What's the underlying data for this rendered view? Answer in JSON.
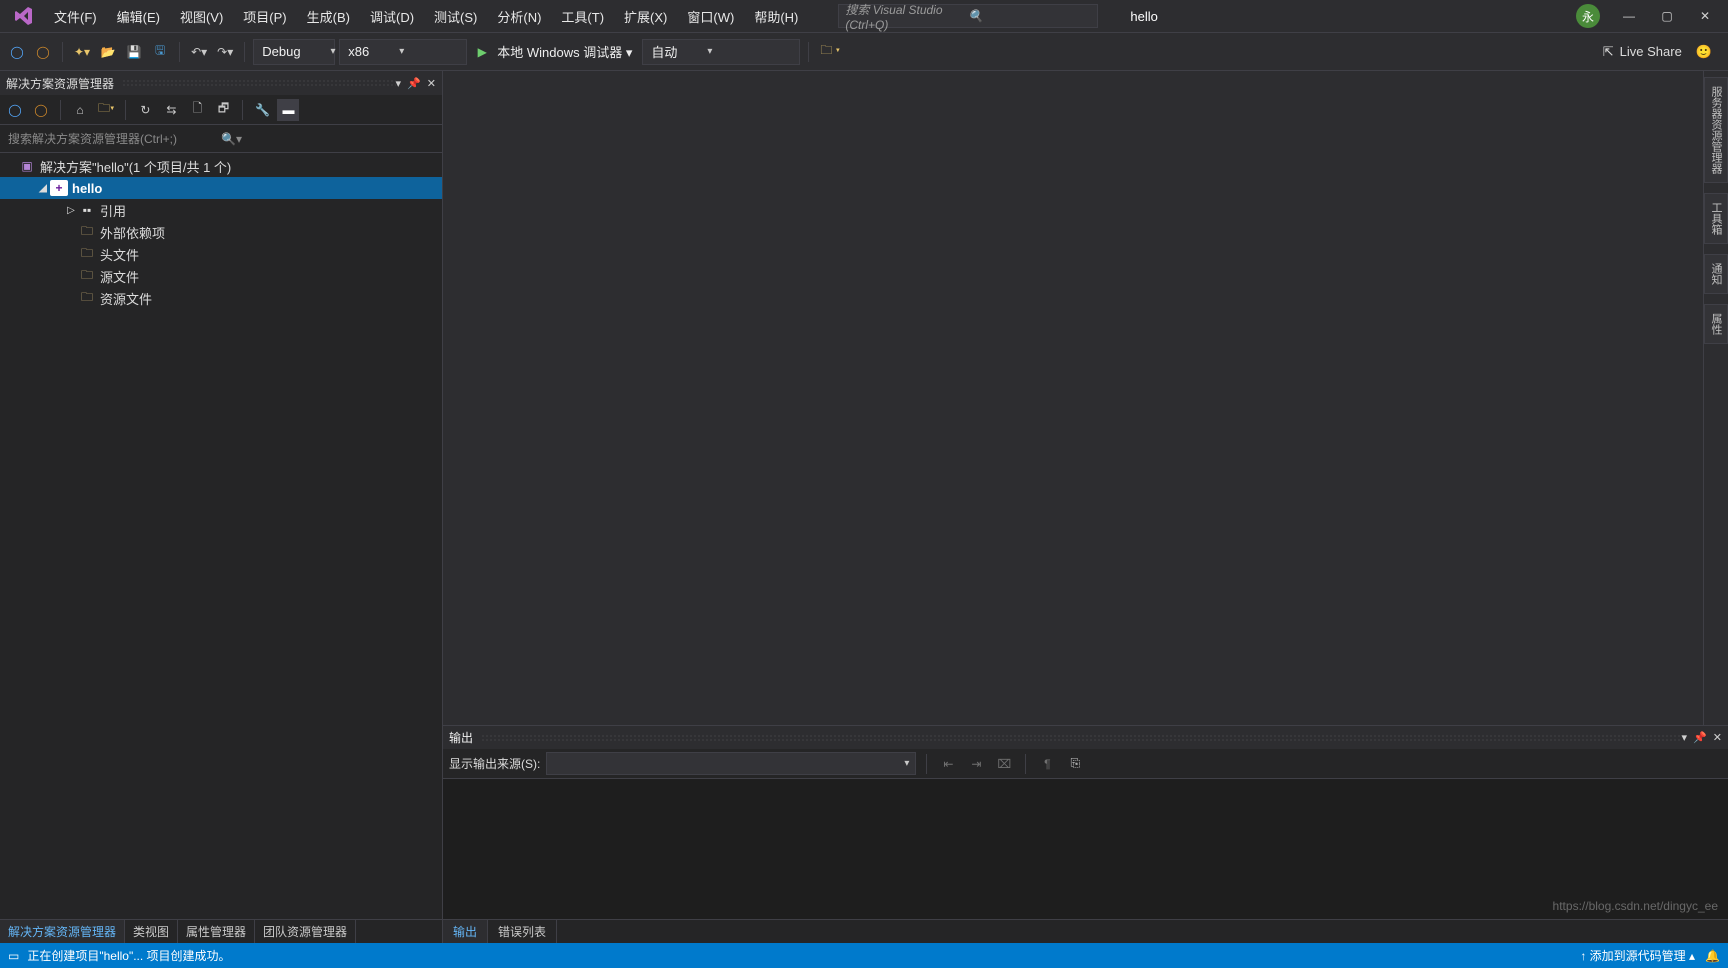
{
  "menu": {
    "items": [
      "文件(F)",
      "编辑(E)",
      "视图(V)",
      "项目(P)",
      "生成(B)",
      "调试(D)",
      "测试(S)",
      "分析(N)",
      "工具(T)",
      "扩展(X)",
      "窗口(W)",
      "帮助(H)"
    ]
  },
  "search": {
    "placeholder": "搜索 Visual Studio (Ctrl+Q)"
  },
  "project": {
    "name": "hello"
  },
  "user": {
    "badge": "永"
  },
  "toolbar": {
    "config": "Debug",
    "platform": "x86",
    "debugger": "本地 Windows 调试器",
    "auto": "自动",
    "liveshare": "Live Share"
  },
  "sln": {
    "title": "解决方案资源管理器",
    "search_placeholder": "搜索解决方案资源管理器(Ctrl+;)",
    "root": "解决方案\"hello\"(1 个项目/共 1 个)",
    "project": "hello",
    "nodes": [
      "引用",
      "外部依赖项",
      "头文件",
      "源文件",
      "资源文件"
    ],
    "tabs": [
      "解决方案资源管理器",
      "类视图",
      "属性管理器",
      "团队资源管理器"
    ]
  },
  "right_tabs": [
    "服务器资源管理器",
    "工具箱",
    "通知",
    "属性"
  ],
  "output": {
    "title": "输出",
    "source_label": "显示输出来源(S):",
    "tabs": [
      "输出",
      "错误列表"
    ]
  },
  "status": {
    "left_icon": "▭",
    "message": "正在创建项目\"hello\"... 项目创建成功。",
    "right": "↑  添加到源代码管理 ▴",
    "watermark": "https://blog.csdn.net/dingyc_ee"
  }
}
